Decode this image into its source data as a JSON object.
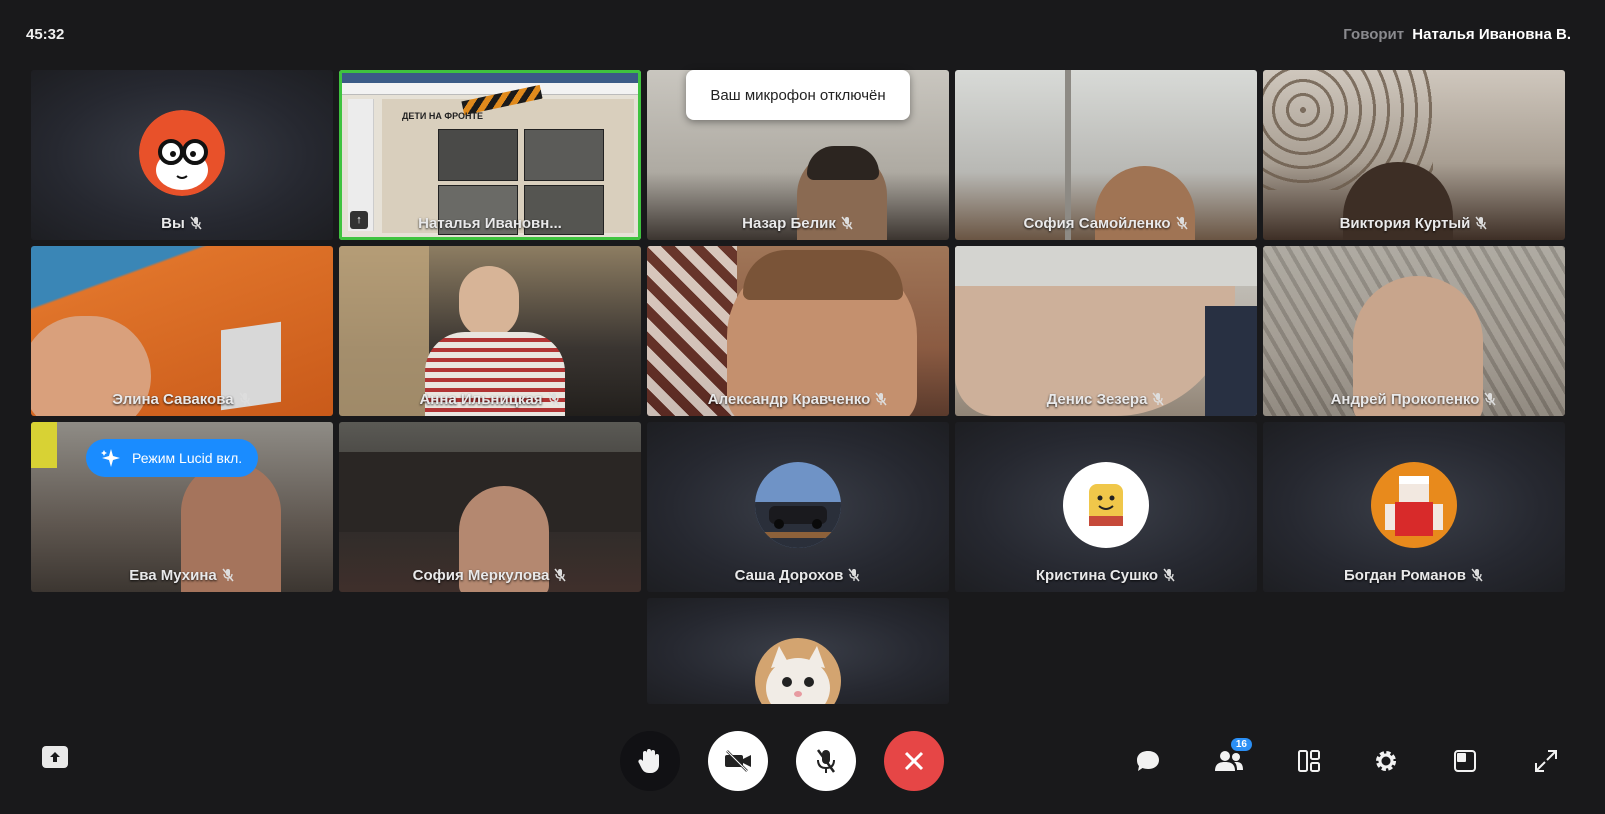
{
  "header": {
    "timer": "45:32",
    "speaker_prefix": "Говорит",
    "speaker_name": "Наталья Ивановна В."
  },
  "toast": "Ваш микрофон отключён",
  "lucid_badge": "Режим Lucid вкл.",
  "slide_title": "ДЕТИ НА ФРОНТЕ",
  "participants": [
    {
      "name": "Вы",
      "muted": true
    },
    {
      "name": "Наталья Ивановн...",
      "muted": false,
      "active": true
    },
    {
      "name": "Назар Белик",
      "muted": true
    },
    {
      "name": "София Самойленко",
      "muted": true
    },
    {
      "name": "Виктория Куртый",
      "muted": true
    },
    {
      "name": "Элина Савакова",
      "muted": true
    },
    {
      "name": "Анна Ильницкая",
      "muted": true
    },
    {
      "name": "Александр Кравченко",
      "muted": true
    },
    {
      "name": "Денис Зезера",
      "muted": true
    },
    {
      "name": "Андрей Прокопенко",
      "muted": true
    },
    {
      "name": "Ева Мухина",
      "muted": true
    },
    {
      "name": "София Меркулова",
      "muted": true
    },
    {
      "name": "Саша Дорохов",
      "muted": true
    },
    {
      "name": "Кристина Сушко",
      "muted": true
    },
    {
      "name": "Богдан Романов",
      "muted": true
    }
  ],
  "toolbar": {
    "participants_count": "16",
    "icons": [
      "upload-icon",
      "raise-hand-icon",
      "camera-off-icon",
      "mic-off-icon",
      "end-call-icon",
      "chat-icon",
      "participants-icon",
      "layout-icon",
      "settings-icon",
      "pip-icon",
      "fullscreen-icon"
    ]
  },
  "colors": {
    "background": "#19191b",
    "active_border": "#3fc33f",
    "end_call": "#e64646",
    "lucid": "#1a8cff",
    "badge": "#2b8ff5"
  }
}
